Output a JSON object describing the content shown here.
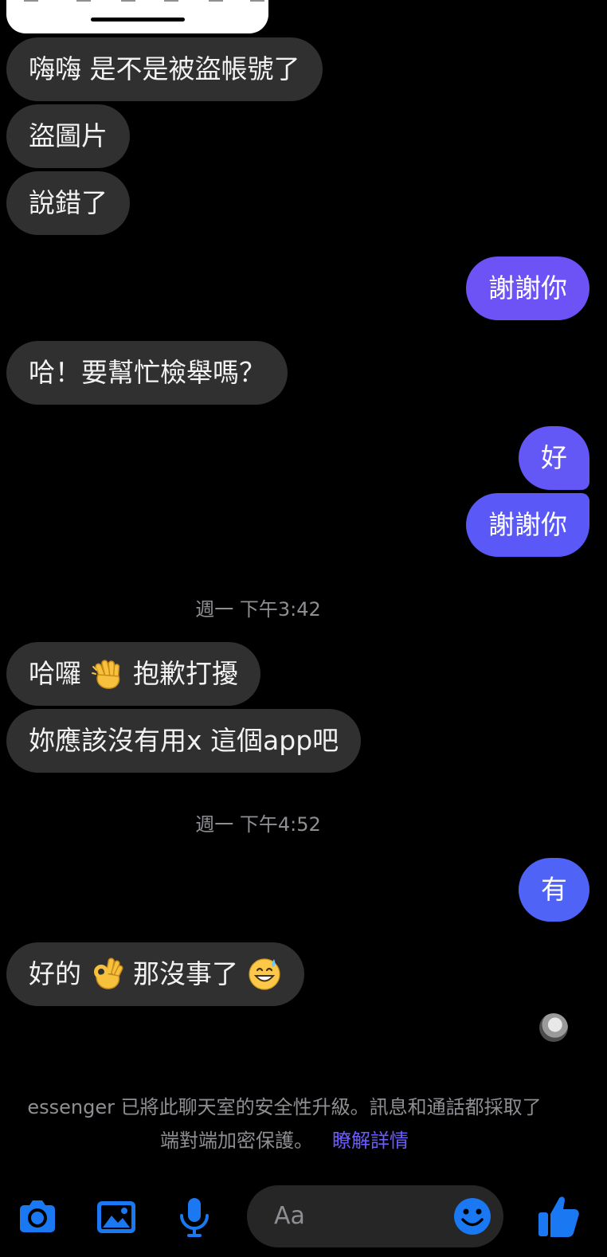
{
  "theme": {
    "incoming_bubble": "#303030",
    "outgoing_purple": "#6d52f5",
    "outgoing_blue": "#4f63f7",
    "accent": "#1a78f2",
    "link": "#6c5cff",
    "muted_text": "#8e8e93"
  },
  "messages": [
    {
      "side": "incoming",
      "text": "嗨嗨 是不是被盜帳號了"
    },
    {
      "side": "incoming",
      "text": "盜圖片"
    },
    {
      "side": "incoming",
      "text": "說錯了"
    },
    {
      "side": "outgoing",
      "text": "謝謝你"
    },
    {
      "side": "incoming",
      "text": "哈！要幫忙檢舉嗎？"
    },
    {
      "side": "outgoing",
      "text": "好"
    },
    {
      "side": "outgoing",
      "text": "謝謝你"
    },
    {
      "type": "timestamp",
      "text": "週一 下午3:42"
    },
    {
      "side": "incoming",
      "text_before": "哈囉",
      "emoji": "waving-hand",
      "text_after": "抱歉打擾"
    },
    {
      "side": "incoming",
      "text": "妳應該沒有用x 這個app吧"
    },
    {
      "type": "timestamp",
      "text": "週一 下午4:52"
    },
    {
      "side": "outgoing",
      "text": "有"
    },
    {
      "side": "incoming",
      "text_before": "好的",
      "emoji": "ok-hand",
      "text_middle": "那沒事了",
      "emoji_2": "grinning-sweat"
    }
  ],
  "read_receipt": {
    "icon": "contact-avatar"
  },
  "encryption_notice": {
    "line1": "essenger 已將此聊天室的安全性升級。訊息和通話都採取了",
    "line2": "端對端加密保護。",
    "link": "瞭解詳情"
  },
  "composer": {
    "placeholder": "Aa",
    "icons": [
      "camera-icon",
      "image-icon",
      "microphone-icon",
      "emoji-icon",
      "thumbs-up-icon"
    ]
  }
}
